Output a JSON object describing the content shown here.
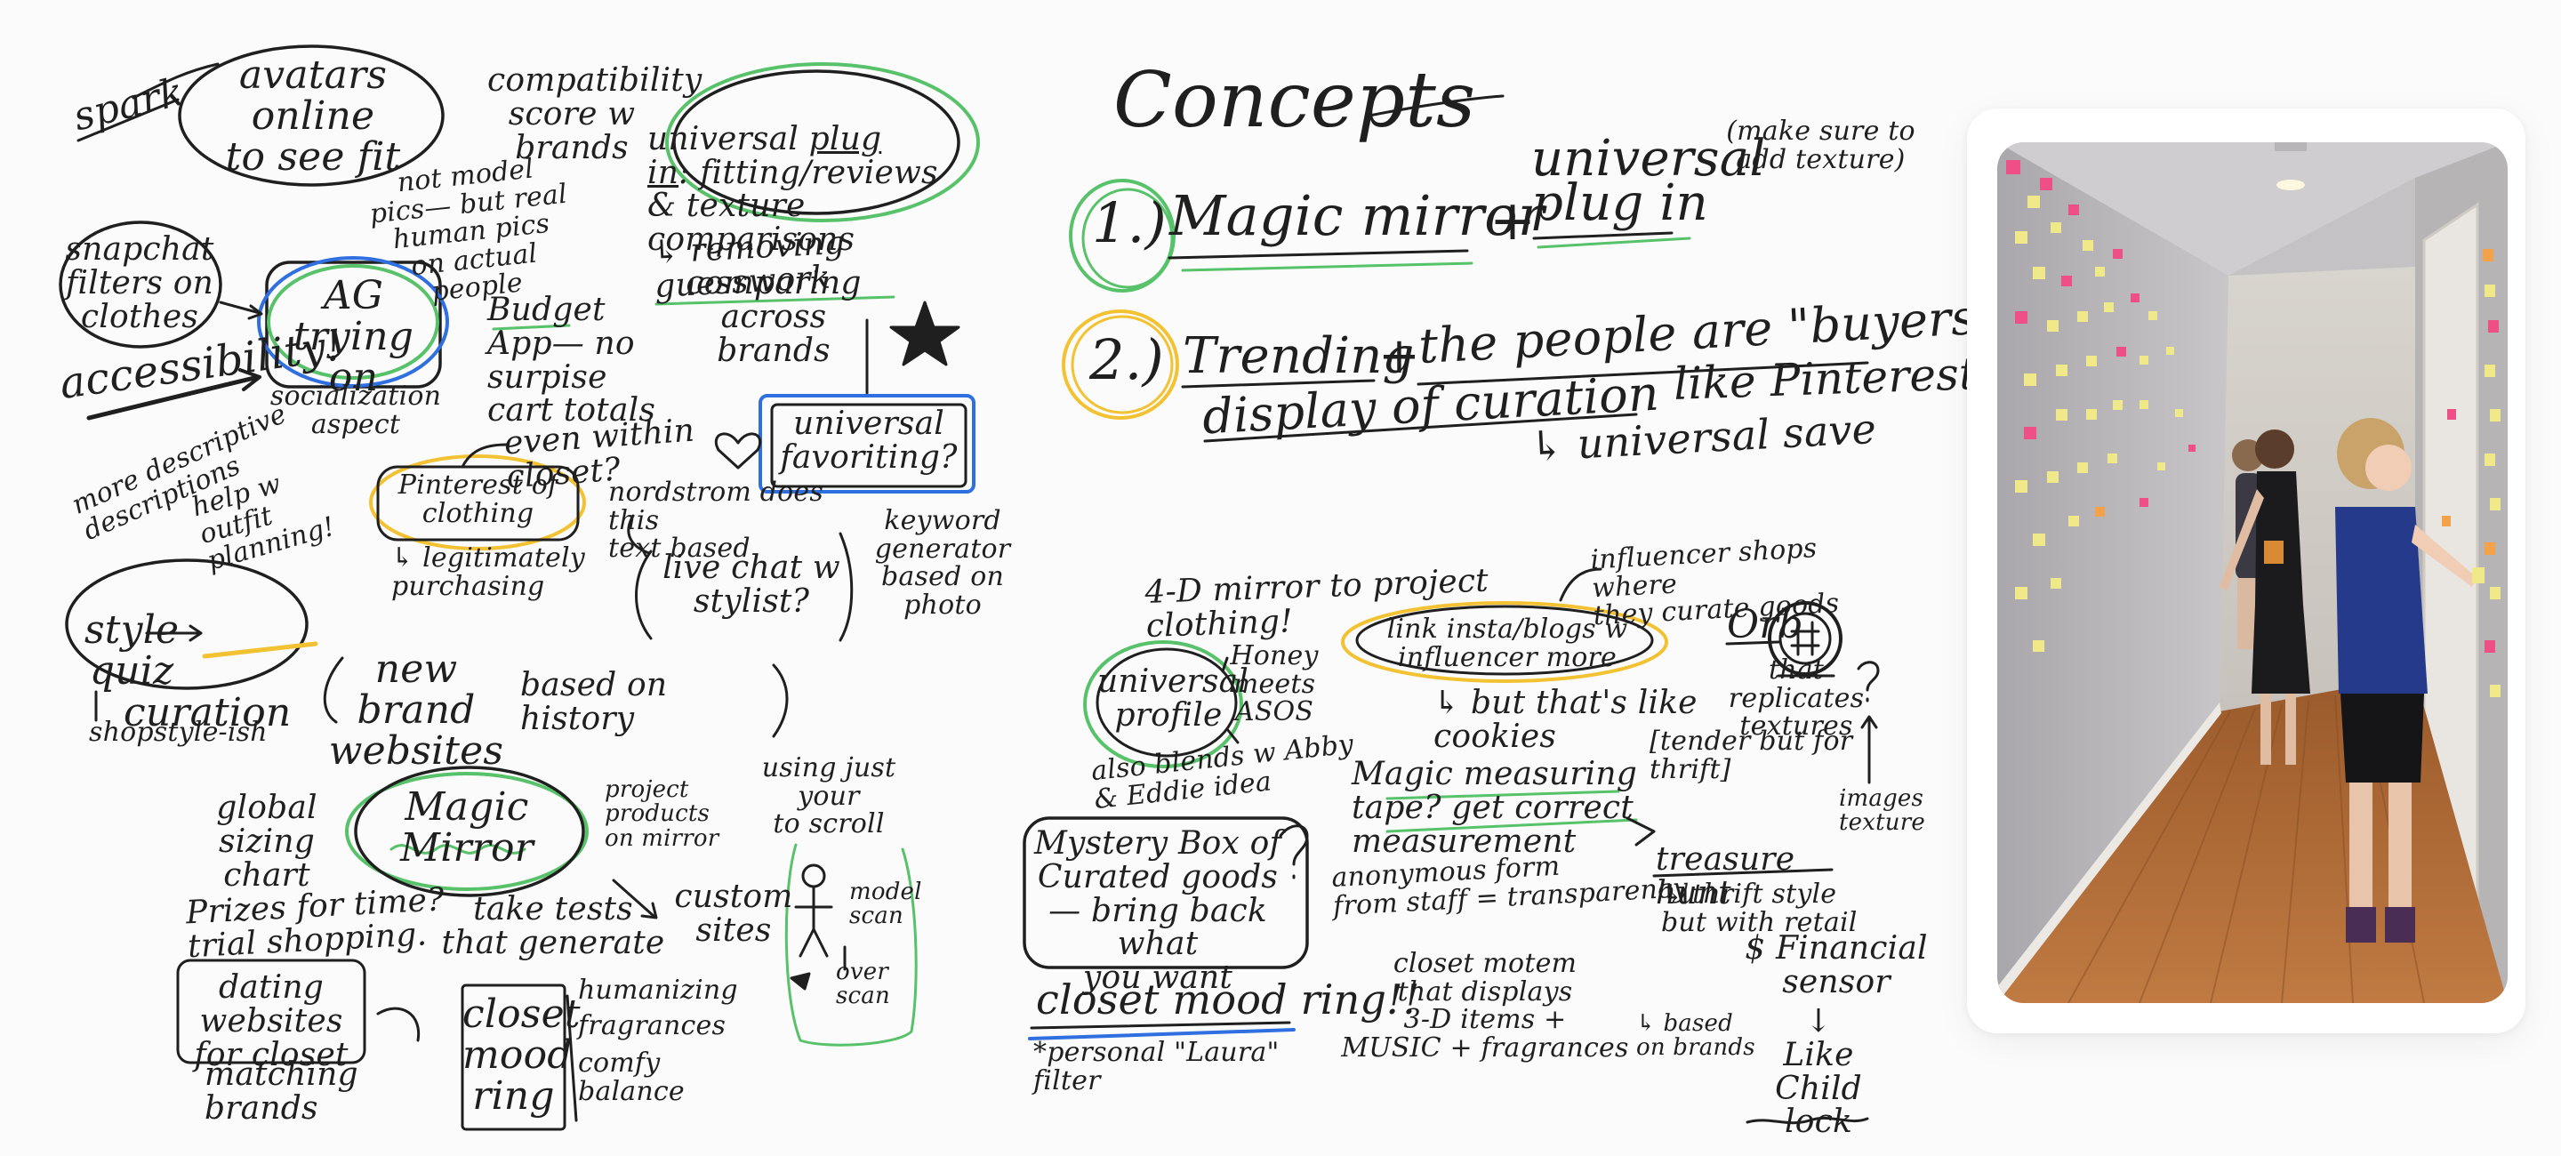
{
  "colors": {
    "ink": "#1f1f1f",
    "green": "#58c26a",
    "blue": "#2f6fe0",
    "yellow": "#f2c232",
    "wall": "#b9b7bb",
    "floor": "#b26a33",
    "sticky_yellow": "#efe98a",
    "sticky_pink": "#ee4f86",
    "sticky_orange": "#f4a24a"
  },
  "icons": {
    "star": "star-icon",
    "heart": "heart-icon",
    "question": "question-mark-icon",
    "figure": "stick-figure-icon"
  },
  "photo": {
    "alt": "photo of people placing sticky notes on a hallway wall"
  },
  "left": {
    "spark": "spark",
    "avatars": "avatars\nonline\nto see fit",
    "compat": "compatibility\nscore w\nbrands",
    "plugin_title_a": "universal ",
    "plugin_title_b": "plug\nin",
    "plugin_title_c": ": fitting/reviews\n& texture comparisons",
    "not_model": "not model\npics— but real\nhuman pics\non actual\npeople",
    "snapchat": "snapchat\nfilters on\nclothes",
    "ag": "AG\ntrying on",
    "budget": "Budget\nApp— no\nsurpise\ncart totals",
    "removing": "↳ removing guesswork",
    "comparing": "comparing across\nbrands",
    "accessibility": "accessibility!",
    "socialization": "socialization\naspect",
    "even_within": "even within closet?",
    "universal_fav": "universal\nfavoriting?",
    "more_desc": "more descriptive\ndescriptions",
    "help_outfit": "help w\noutfit\nplanning!",
    "pinterest_clothing": "Pinterest of\nclothing",
    "nordstrom": "nordstrom does this\ntext based",
    "keyword": "keyword\ngenerator\nbased on\nphoto",
    "legit": "↳ legitimately\npurchasing",
    "live_chat": "live chat w\nstylist?",
    "style_quiz_a": "style\nquiz",
    "style_quiz_b": "curation",
    "new_brand": "new brand\nwebsites",
    "based_history": "based on history",
    "shopstyle": "shopstyle-ish",
    "global_sizing": "global sizing\nchart",
    "magic_mirror": "Magic\nMirror",
    "project": "project\nproducts\non mirror",
    "using_just": "using just\nyour\nto scroll",
    "prizes": "Prizes for time?\ntrial shopping.",
    "take_tests": "take tests\nthat generate",
    "custom_sites": "custom\nsites",
    "model_scan": "model\nscan",
    "over_scan": "over\nscan",
    "dating": "dating websites\nfor closet",
    "closet_mood": "closet\nmood\nring",
    "humanizing": "humanizing",
    "fragrances": "fragrances",
    "comfy": "comfy balance",
    "matching": "matching brands"
  },
  "right": {
    "concepts": "Concepts",
    "c1_num": "1.)",
    "c1_text": "Magic mirror",
    "c1_plus": "+",
    "c1_universal": "universal",
    "c1_plugin": "plug in",
    "c1_note": "(make sure to\nadd texture)",
    "c2_num": "2.)",
    "c2_trending": "Trending",
    "c2_plus": "+",
    "c2_people": "the people are \"buyers\"",
    "c2_display": "display of curation",
    "c2_pinterest": "like Pinterest",
    "c2_save": "↳ universal save",
    "mirror_4d": "4-D mirror to project clothing!",
    "influencer_shops": "influencer shops where\nthey curate goods",
    "universal_profile": "universal\nprofile",
    "honey": "Honey\nmeets\nASOS",
    "link_insta": "link insta/blogs w\ninfluencer more",
    "orb": "Orb",
    "orb_text": "that\nreplicates\ntextures",
    "cookies": "↳ but that's like\ncookies",
    "also_blends": "also blends w Abby\n& Eddie idea",
    "magic_measuring": "Magic measuring\ntape? get correct\nmeasurement",
    "tender": "[tender but for\nthrift]",
    "images_texture": "images\ntexture",
    "mystery_box": "Mystery Box of\nCurated goods\n— bring back what\nyou want",
    "anonymous": "anonymous form\nfrom staff = transparency",
    "treasure": "treasure hunt",
    "thrift_style": "↳ thrift style\nbut with retail",
    "closet_mood_ring": "closet mood ring!!",
    "closet_motem": "closet    motem\nthat displays\n3-D items +\nMUSIC + fragrances",
    "based_brands": "↳ based\non brands",
    "financial": "$ Financial\nsensor",
    "like_child": "↓\nLike\nChild lock",
    "personal": "*personal \"Laura\" filter"
  }
}
